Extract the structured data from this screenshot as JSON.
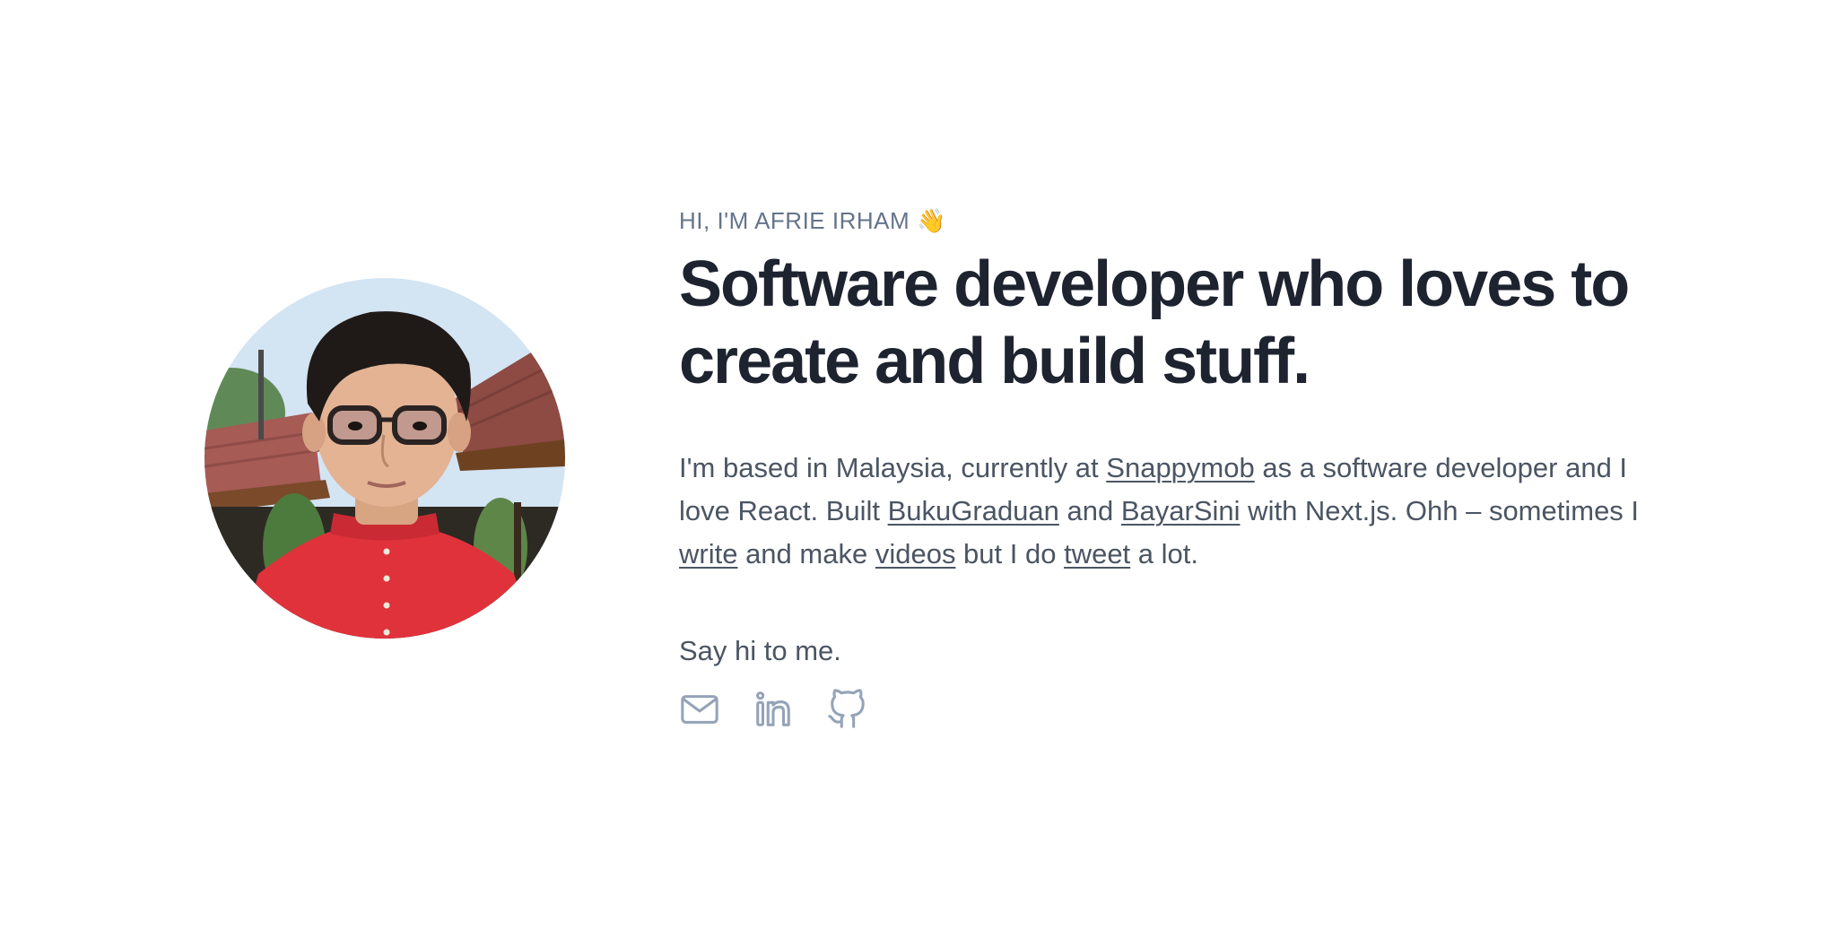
{
  "intro": {
    "eyebrow": "HI, I'M AFRIE IRHAM",
    "wave_emoji": "👋",
    "headline": "Software developer who loves to create and build stuff."
  },
  "bio": {
    "t1": "I'm based in Malaysia, currently at ",
    "link_snappymob": "Snappymob",
    "t2": " as a software developer and I love React. Built ",
    "link_bukugraduan": "BukuGraduan",
    "t3": " and ",
    "link_bayarsini": "BayarSini",
    "t4": " with Next.js. Ohh – sometimes I ",
    "link_write": "write",
    "t5": " and make ",
    "link_videos": "videos",
    "t6": " but I do ",
    "link_tweet": "tweet",
    "t7": " a lot."
  },
  "contact": {
    "say_hi": "Say hi to me.",
    "icons": [
      "mail-icon",
      "linkedin-icon",
      "github-icon"
    ]
  },
  "colors": {
    "headline": "#1e2330",
    "body": "#4b5563",
    "muted": "#64748b",
    "icon": "#94a3b8"
  }
}
